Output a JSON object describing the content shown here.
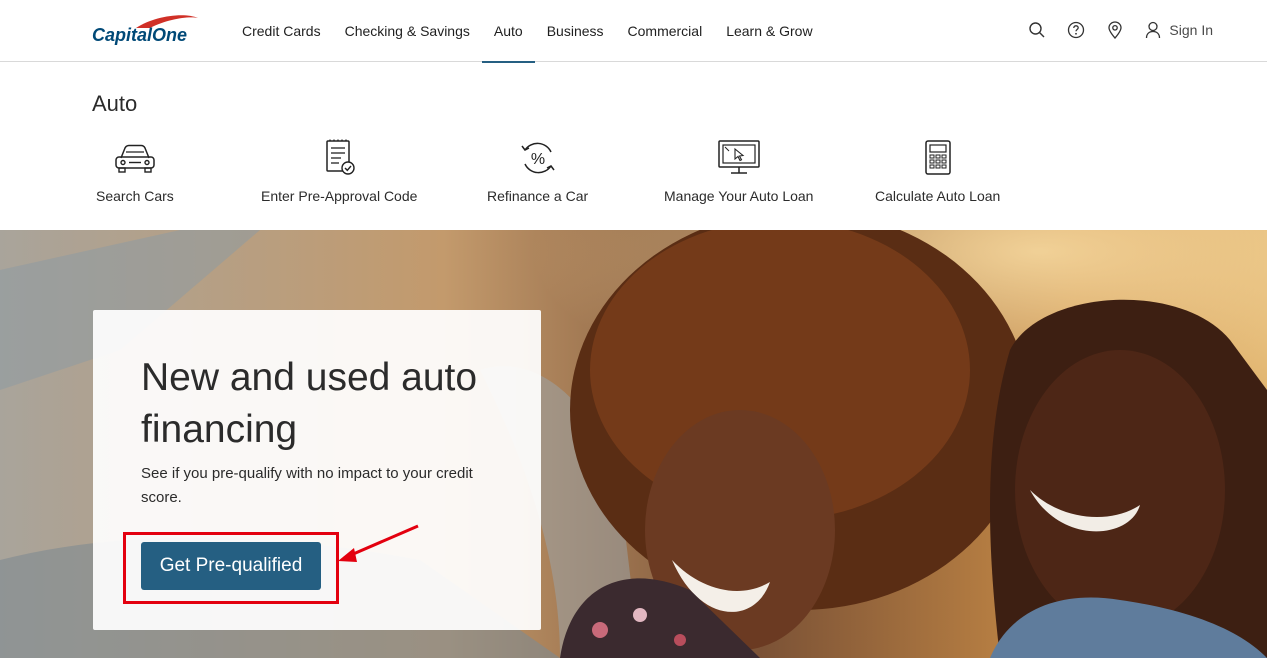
{
  "brand": {
    "name": "Capital One",
    "logo_text": "CapitalOne",
    "primary": "#255f82",
    "logo_red": "#d03027",
    "logo_navy": "#004977"
  },
  "nav": {
    "items": [
      {
        "label": "Credit Cards",
        "active": false
      },
      {
        "label": "Checking & Savings",
        "active": false
      },
      {
        "label": "Auto",
        "active": true
      },
      {
        "label": "Business",
        "active": false
      },
      {
        "label": "Commercial",
        "active": false
      },
      {
        "label": "Learn & Grow",
        "active": false
      }
    ],
    "utilities": [
      "search-icon",
      "help-icon",
      "location-pin-icon",
      "user-icon"
    ],
    "sign_in": "Sign In"
  },
  "auto": {
    "title": "Auto",
    "quicklinks": [
      {
        "label": "Search Cars",
        "icon": "car-icon"
      },
      {
        "label": "Enter Pre-Approval Code",
        "icon": "document-check-icon"
      },
      {
        "label": "Refinance a Car",
        "icon": "percent-refresh-icon"
      },
      {
        "label": "Manage Your Auto Loan",
        "icon": "monitor-cursor-icon"
      },
      {
        "label": "Calculate Auto Loan",
        "icon": "calculator-icon"
      }
    ]
  },
  "hero": {
    "heading": "New and used auto financing",
    "subtext": "See if you pre-qualify with no impact to your credit score.",
    "cta_label": "Get Pre-qualified",
    "annotation_color": "#e3000f"
  }
}
